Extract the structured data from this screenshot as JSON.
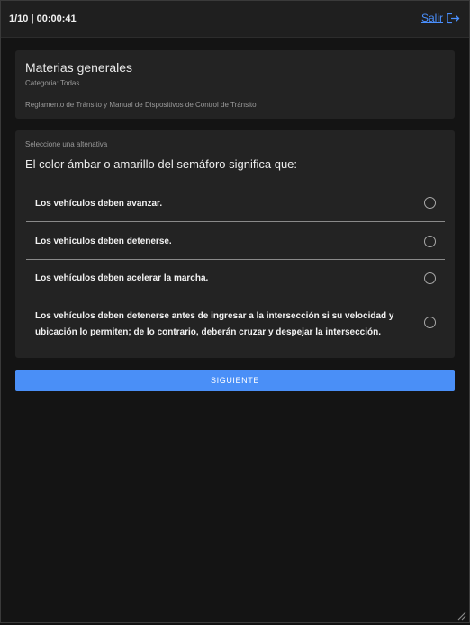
{
  "header": {
    "progress": "1/10 | 00:00:41",
    "exit_label": "Salir",
    "exit_icon": "logout-icon",
    "accent_color": "#4a90ff"
  },
  "info": {
    "title": "Materias generales",
    "category": "Categoria: Todas",
    "reference": "Reglamento de Tránsito y Manual de Dispositivos de Control de Tránsito"
  },
  "question": {
    "hint": "Seleccione una altenativa",
    "text": "El color ámbar o amarillo del semáforo significa que:",
    "options": [
      {
        "label": "Los vehículos deben avanzar.",
        "selected": false
      },
      {
        "label": "Los vehículos deben detenerse.",
        "selected": false
      },
      {
        "label": "Los vehículos deben acelerar la marcha.",
        "selected": false
      },
      {
        "label": "Los vehículos deben detenerse antes de ingresar a la intersección si su velocidad y ubicación lo permiten; de lo contrario, deberán cruzar y despejar la intersección.",
        "selected": false
      }
    ]
  },
  "actions": {
    "next_label": "SIGUIENTE",
    "next_color": "#4a8ff7"
  }
}
